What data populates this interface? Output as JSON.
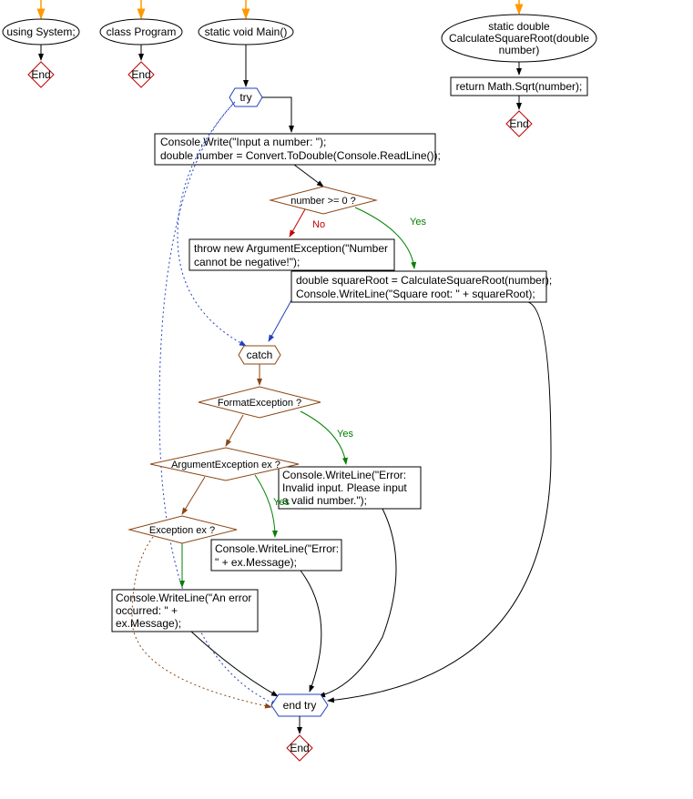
{
  "nodes": {
    "using_system": "using System;",
    "class_program": "class Program",
    "main": "static void Main()",
    "calc_sqrt_l1": "static double",
    "calc_sqrt_l2": "CalculateSquareRoot(double",
    "calc_sqrt_l3": "number)",
    "return_sqrt": "return Math.Sqrt(number);",
    "try": "try",
    "catch": "catch",
    "end_try": "end try",
    "end": "End",
    "input_l1": "Console.Write(\"Input a number: \");",
    "input_l2": "double number = Convert.ToDouble(Console.ReadLine());",
    "cond_number": "number >= 0 ?",
    "throw_l1": "throw new ArgumentException(\"Number",
    "throw_l2": "cannot be negative!\");",
    "sqrt_l1": "double squareRoot = CalculateSquareRoot(number);",
    "sqrt_l2": "Console.WriteLine(\"Square root: \" + squareRoot);",
    "cond_format": "FormatException ?",
    "cond_argex": "ArgumentException ex ?",
    "cond_ex": "Exception ex ?",
    "err_format_l1": "Console.WriteLine(\"Error:",
    "err_format_l2": "Invalid input. Please input",
    "err_format_l3": "a valid number.\");",
    "err_argex_l1": "Console.WriteLine(\"Error:",
    "err_argex_l2": "\" + ex.Message);",
    "err_ex_l1": "Console.WriteLine(\"An error",
    "err_ex_l2": "occurred: \" +",
    "err_ex_l3": "ex.Message);"
  },
  "labels": {
    "yes": "Yes",
    "no": "No"
  },
  "colors": {
    "blue": "#2040c0",
    "brown": "#8b4513",
    "orange": "#ff9900",
    "red": "#c00000",
    "green": "#008000",
    "black": "#000000"
  }
}
